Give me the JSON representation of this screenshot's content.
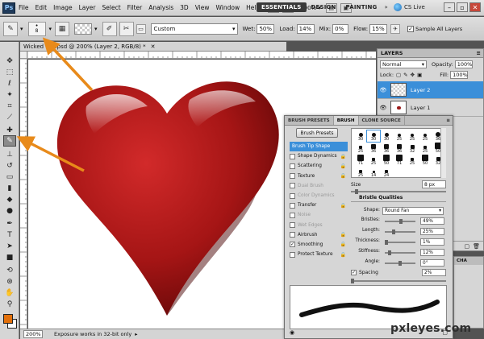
{
  "menu": {
    "logo": "Ps",
    "items": [
      "File",
      "Edit",
      "Image",
      "Layer",
      "Select",
      "Filter",
      "Analysis",
      "3D",
      "View",
      "Window",
      "Help"
    ],
    "zoom": "200%",
    "workspaces": [
      "ESSENTIALS",
      "DESIGN",
      "PAINTING"
    ],
    "cslive": "CS Live"
  },
  "options": {
    "brush_size": "8",
    "preset": "Custom",
    "wet_label": "Wet:",
    "wet": "50%",
    "load_label": "Load:",
    "load": "14%",
    "mix_label": "Mix:",
    "mix": "0%",
    "flow_label": "Flow:",
    "flow": "15%",
    "sample_all": "Sample All Layers"
  },
  "document": {
    "tab_title": "Wicked Gr...psd @ 200% (Layer 2, RGB/8) *",
    "status_zoom": "200%",
    "status_message": "Exposure works in 32-bit only"
  },
  "layers_panel": {
    "tab": "LAYERS",
    "blend_mode": "Normal",
    "opacity_label": "Opacity:",
    "opacity": "100%",
    "lock_label": "Lock:",
    "fill_label": "Fill:",
    "fill": "100%",
    "layers": [
      "Layer 2",
      "Layer 1"
    ]
  },
  "brush_panel": {
    "tabs": [
      "BRUSH PRESETS",
      "BRUSH",
      "CLONE SOURCE"
    ],
    "presets_button": "Brush Presets",
    "options": [
      {
        "label": "Brush Tip Shape",
        "checked": false,
        "enabled": true,
        "selected": true
      },
      {
        "label": "Shape Dynamics",
        "checked": false,
        "enabled": true
      },
      {
        "label": "Scattering",
        "checked": false,
        "enabled": true
      },
      {
        "label": "Texture",
        "checked": false,
        "enabled": true
      },
      {
        "label": "Dual Brush",
        "checked": false,
        "enabled": false
      },
      {
        "label": "Color Dynamics",
        "checked": false,
        "enabled": false
      },
      {
        "label": "Transfer",
        "checked": false,
        "enabled": true
      },
      {
        "label": "Noise",
        "checked": false,
        "enabled": false
      },
      {
        "label": "Wet Edges",
        "checked": false,
        "enabled": false
      },
      {
        "label": "Airbrush",
        "checked": false,
        "enabled": true
      },
      {
        "label": "Smoothing",
        "checked": true,
        "enabled": true
      },
      {
        "label": "Protect Texture",
        "checked": false,
        "enabled": true
      }
    ],
    "tip_sizes": [
      "30",
      "30",
      "30",
      "25",
      "25",
      "25",
      "36",
      "25",
      "36",
      "36",
      "36",
      "32",
      "25",
      "50",
      "71",
      "25",
      "50",
      "71",
      "25",
      "50",
      "32",
      "25",
      "14",
      "24"
    ],
    "size_label": "Size",
    "size": "8 px",
    "bristle_title": "Bristle Qualities",
    "shape_label": "Shape:",
    "shape": "Round Fan",
    "bristles_label": "Bristles:",
    "bristles": "49%",
    "length_label": "Length:",
    "length": "25%",
    "thickness_label": "Thickness:",
    "thickness": "1%",
    "stiffness_label": "Stiffness:",
    "stiffness": "12%",
    "angle_label": "Angle:",
    "angle": "0°",
    "spacing_label": "Spacing",
    "spacing": "2%"
  },
  "side_panel": {
    "title": "CHA"
  },
  "watermark": "pxleyes.com"
}
